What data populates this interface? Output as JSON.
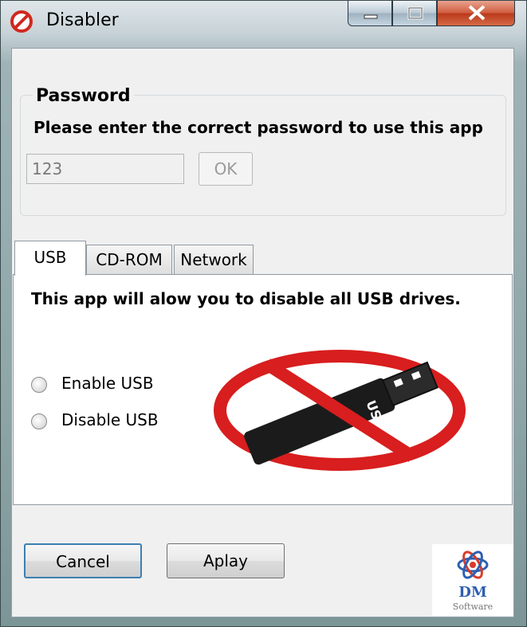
{
  "window": {
    "title": "Disabler"
  },
  "password_group": {
    "legend": "Password",
    "prompt": "Please enter the correct password to use this app",
    "input_value": "123",
    "ok_label": "OK"
  },
  "tabs": [
    {
      "label": "USB",
      "selected": true
    },
    {
      "label": "CD-ROM",
      "selected": false
    },
    {
      "label": "Network",
      "selected": false
    }
  ],
  "usb_panel": {
    "description": "This app will alow you to disable all USB drives.",
    "options": [
      {
        "label": "Enable USB",
        "checked": false
      },
      {
        "label": "Disable USB",
        "checked": false
      }
    ],
    "image_text": "USB"
  },
  "footer": {
    "cancel_label": "Cancel",
    "apply_label": "Aplay",
    "logo": {
      "name": "DM",
      "subtitle": "Software"
    }
  },
  "colors": {
    "no_symbol_red": "#d81e1e",
    "focus_border": "#3c7fb1",
    "logo_blue": "#2e5fb0"
  },
  "icons": {
    "app": "no-entry-icon",
    "usb_image": "usb-prohibited-icon",
    "logo": "atom-logo-icon"
  }
}
